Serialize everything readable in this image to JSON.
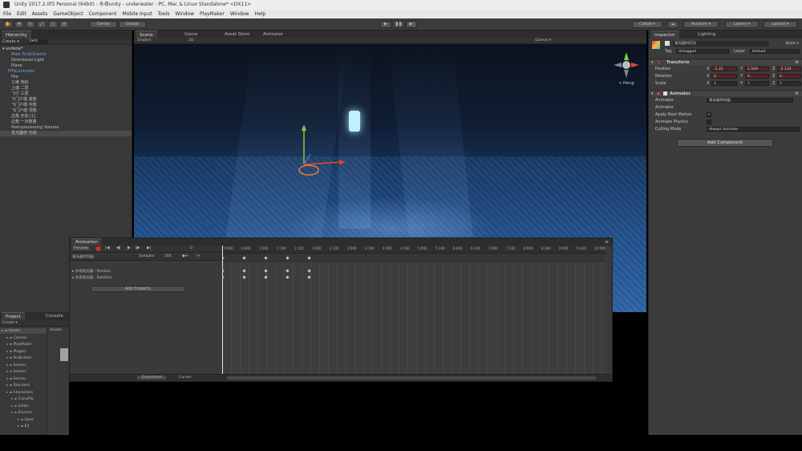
{
  "window": {
    "title": "Unity 2017.2.0f3 Personal (64bit) - 水母unity - underwater - PC, Mac & Linux Standalone* <DX11>"
  },
  "menu": [
    "File",
    "Edit",
    "Assets",
    "GameObject",
    "Component",
    "Mobile Input",
    "Tools",
    "Window",
    "PlayMaker",
    "Window",
    "Help"
  ],
  "toolbar": {
    "center_label": "Center",
    "global_label": "Global",
    "collab_label": "Collab ▾",
    "account_label": "Account ▾",
    "layers_label": "Layers ▾",
    "layout_label": "Layout ▾"
  },
  "hierarchy": {
    "tab": "Hierarchy",
    "create": "Create ▾",
    "search": "Q▾All",
    "scene": "underw*",
    "items": [
      "Main FirstDirector",
      "Directional Light",
      "Plane",
      "FPSController",
      "Fire",
      "三维 地标",
      "上端 二层",
      "飞行 三层",
      "下门户端 底部",
      "飞门户端 中部",
      "飞门户端 顶部",
      "边角 天际 [1]",
      "边角 一对数量",
      "Post-processing Volume",
      "发光器材 光线"
    ]
  },
  "scene_tabs": {
    "scene": "Scene",
    "game": "Game",
    "asset_store": "Asset Store",
    "animator": "Animator"
  },
  "scene_toolbar": {
    "shaded": "Shaded",
    "mode2d": "2D",
    "gizmos": "Gizmos ▾"
  },
  "animation": {
    "tab": "Animation",
    "preview": "Preview",
    "frame": "0",
    "clip": "发光器材动画",
    "samples_label": "Samples",
    "samples_value": "200",
    "ruler": [
      "0:000",
      "0:000",
      "1:000",
      "1:100",
      "1:110",
      "2:000",
      "2:100",
      "3:000",
      "3:100",
      "4:000",
      "4:100",
      "5:000",
      "5:100",
      "6:000",
      "6:100",
      "7:000",
      "7:100",
      "8:000",
      "8:100",
      "9:000",
      "9:100",
      "10:000"
    ],
    "properties": [
      {
        "label": "水母发光器 : Position"
      },
      {
        "label": "水母发光器 : Rotation"
      }
    ],
    "add_property": "Add Property",
    "dopesheet": "Dopesheet",
    "curves": "Curves"
  },
  "project": {
    "tab": "Project",
    "console": "Console",
    "create": "Create ▾",
    "folders": [
      "Assets",
      "Comms",
      "PlayMaker",
      "Plugins",
      "ProBuilder",
      "Scenes",
      "Scenes",
      "Scenes",
      "Standard",
      "Characters",
      "CrossPla",
      "Editor",
      "Environ",
      "Spee",
      "Ed"
    ],
    "assets_label": "Assets"
  },
  "inspector": {
    "tab": "Inspector",
    "lighting_tab": "Lighting",
    "object_name": "发光器材灯光",
    "static": "Static ▾",
    "tag_label": "Tag",
    "tag_value": "Untagged",
    "layer_label": "Layer",
    "layer_value": "Default",
    "transform": {
      "title": "Transform",
      "position_label": "Position",
      "rotation_label": "Rotation",
      "scale_label": "Scale",
      "position": {
        "x": "-2.32",
        "y": "1.509",
        "z": "-2.134"
      },
      "rotation": {
        "x": "0",
        "y": "0",
        "z": "0"
      },
      "scale": {
        "x": "1",
        "y": "1",
        "z": "1"
      }
    },
    "animator": {
      "title": "Animator",
      "controller_label": "Animator",
      "controller_value": "发光器材动画",
      "avatar_label": "Animator",
      "apply_root_label": "Apply Root Motion",
      "animate_physics_label": "Animate Physics",
      "culling_label": "Culling Mode",
      "culling_value": "Always Animate"
    },
    "add_component": "Add Component"
  }
}
